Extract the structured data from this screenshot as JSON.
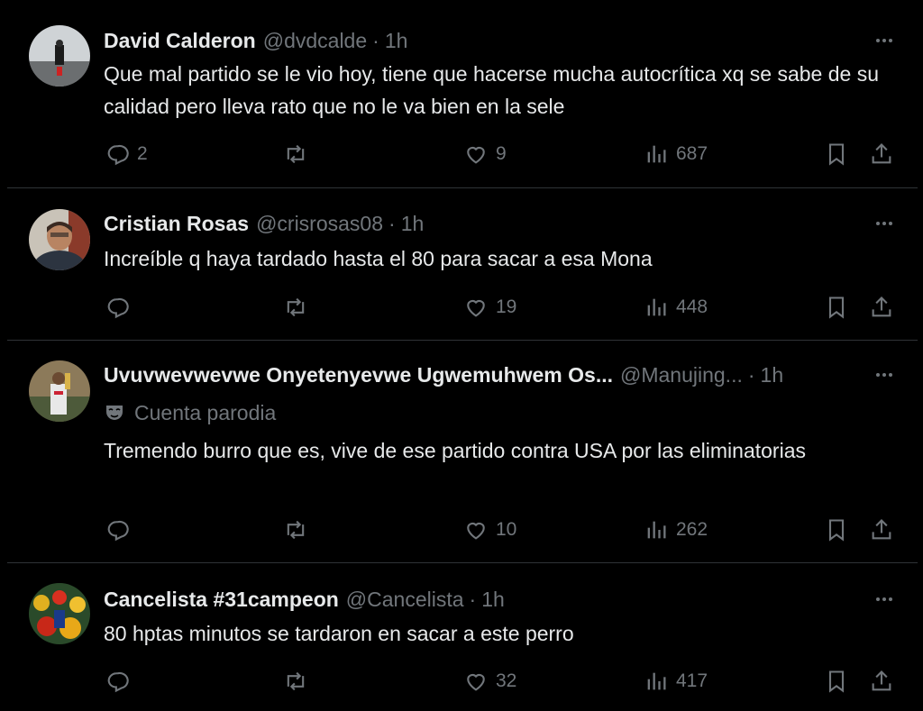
{
  "tweets": [
    {
      "name": "David Calderon",
      "handle": "@dvdcalde",
      "time": "1h",
      "text": "Que mal partido se le vio hoy, tiene que hacerse mucha autocrítica xq se sabe de su calidad pero lleva rato que no le va bien en la sele",
      "replies": "2",
      "retweets": "",
      "likes": "9",
      "views": "687"
    },
    {
      "name": "Cristian Rosas",
      "handle": "@crisrosas08",
      "time": "1h",
      "text": "Increíble q haya tardado hasta el 80 para sacar a esa Mona",
      "replies": "",
      "retweets": "",
      "likes": "19",
      "views": "448"
    },
    {
      "name": "Uvuvwevwevwe Onyetenyevwe Ugwemuhwem Os...",
      "handle": "@Manujing...",
      "time": "1h",
      "label": "Cuenta parodia",
      "text": "Tremendo burro que es, vive de ese partido contra USA por las eliminatorias",
      "replies": "",
      "retweets": "",
      "likes": "10",
      "views": "262"
    },
    {
      "name": "Cancelista #31campeon",
      "handle": "@Cancelista",
      "time": "1h",
      "text": "80 hptas minutos se tardaron en sacar a este perro",
      "replies": "",
      "retweets": "",
      "likes": "32",
      "views": "417"
    }
  ],
  "separator": "·",
  "colors": {
    "background": "#000000",
    "text": "#e7e9ea",
    "muted": "#71767b",
    "border": "#2f3336"
  },
  "icons": [
    "reply-icon",
    "retweet-icon",
    "like-icon",
    "views-icon",
    "bookmark-icon",
    "share-icon",
    "more-icon",
    "parody-mask-icon"
  ]
}
